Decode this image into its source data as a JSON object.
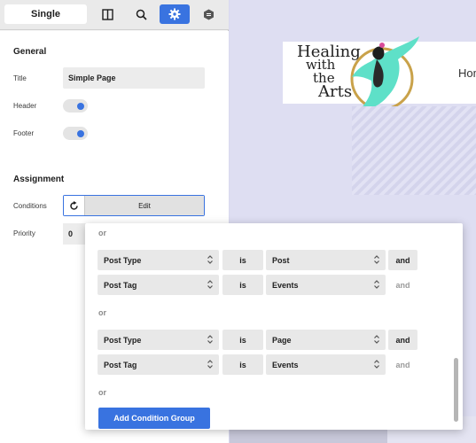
{
  "toolbar": {
    "single_tab": "Single",
    "buttons": [
      "columns-icon",
      "search-icon",
      "gear-icon",
      "stylebook-icon"
    ]
  },
  "sidebar": {
    "general_heading": "General",
    "title_label": "Title",
    "title_value": "Simple Page",
    "header_label": "Header",
    "header_on": true,
    "footer_label": "Footer",
    "footer_on": true,
    "assignment_heading": "Assignment",
    "conditions_label": "Conditions",
    "conditions_edit": "Edit",
    "priority_label": "Priority",
    "priority_value": "0"
  },
  "preview": {
    "logo_line1": "Healing",
    "logo_line2": "with",
    "logo_line3": "the",
    "logo_line4": "Arts",
    "nav_first": "Hom"
  },
  "conditions": {
    "top_or": "or",
    "groups": [
      {
        "rows": [
          {
            "field": "Post Type",
            "op": "is",
            "value": "Post",
            "and": "and"
          },
          {
            "field": "Post Tag",
            "op": "is",
            "value": "Events",
            "and": "and"
          }
        ]
      },
      {
        "rows": [
          {
            "field": "Post Type",
            "op": "is",
            "value": "Page",
            "and": "and"
          },
          {
            "field": "Post Tag",
            "op": "is",
            "value": "Events",
            "and": "and"
          }
        ]
      }
    ],
    "or_label": "or",
    "add_group_label": "Add Condition Group"
  },
  "colors": {
    "accent": "#3973e0",
    "teal": "#5ee0c8",
    "gold": "#c9a24a"
  }
}
